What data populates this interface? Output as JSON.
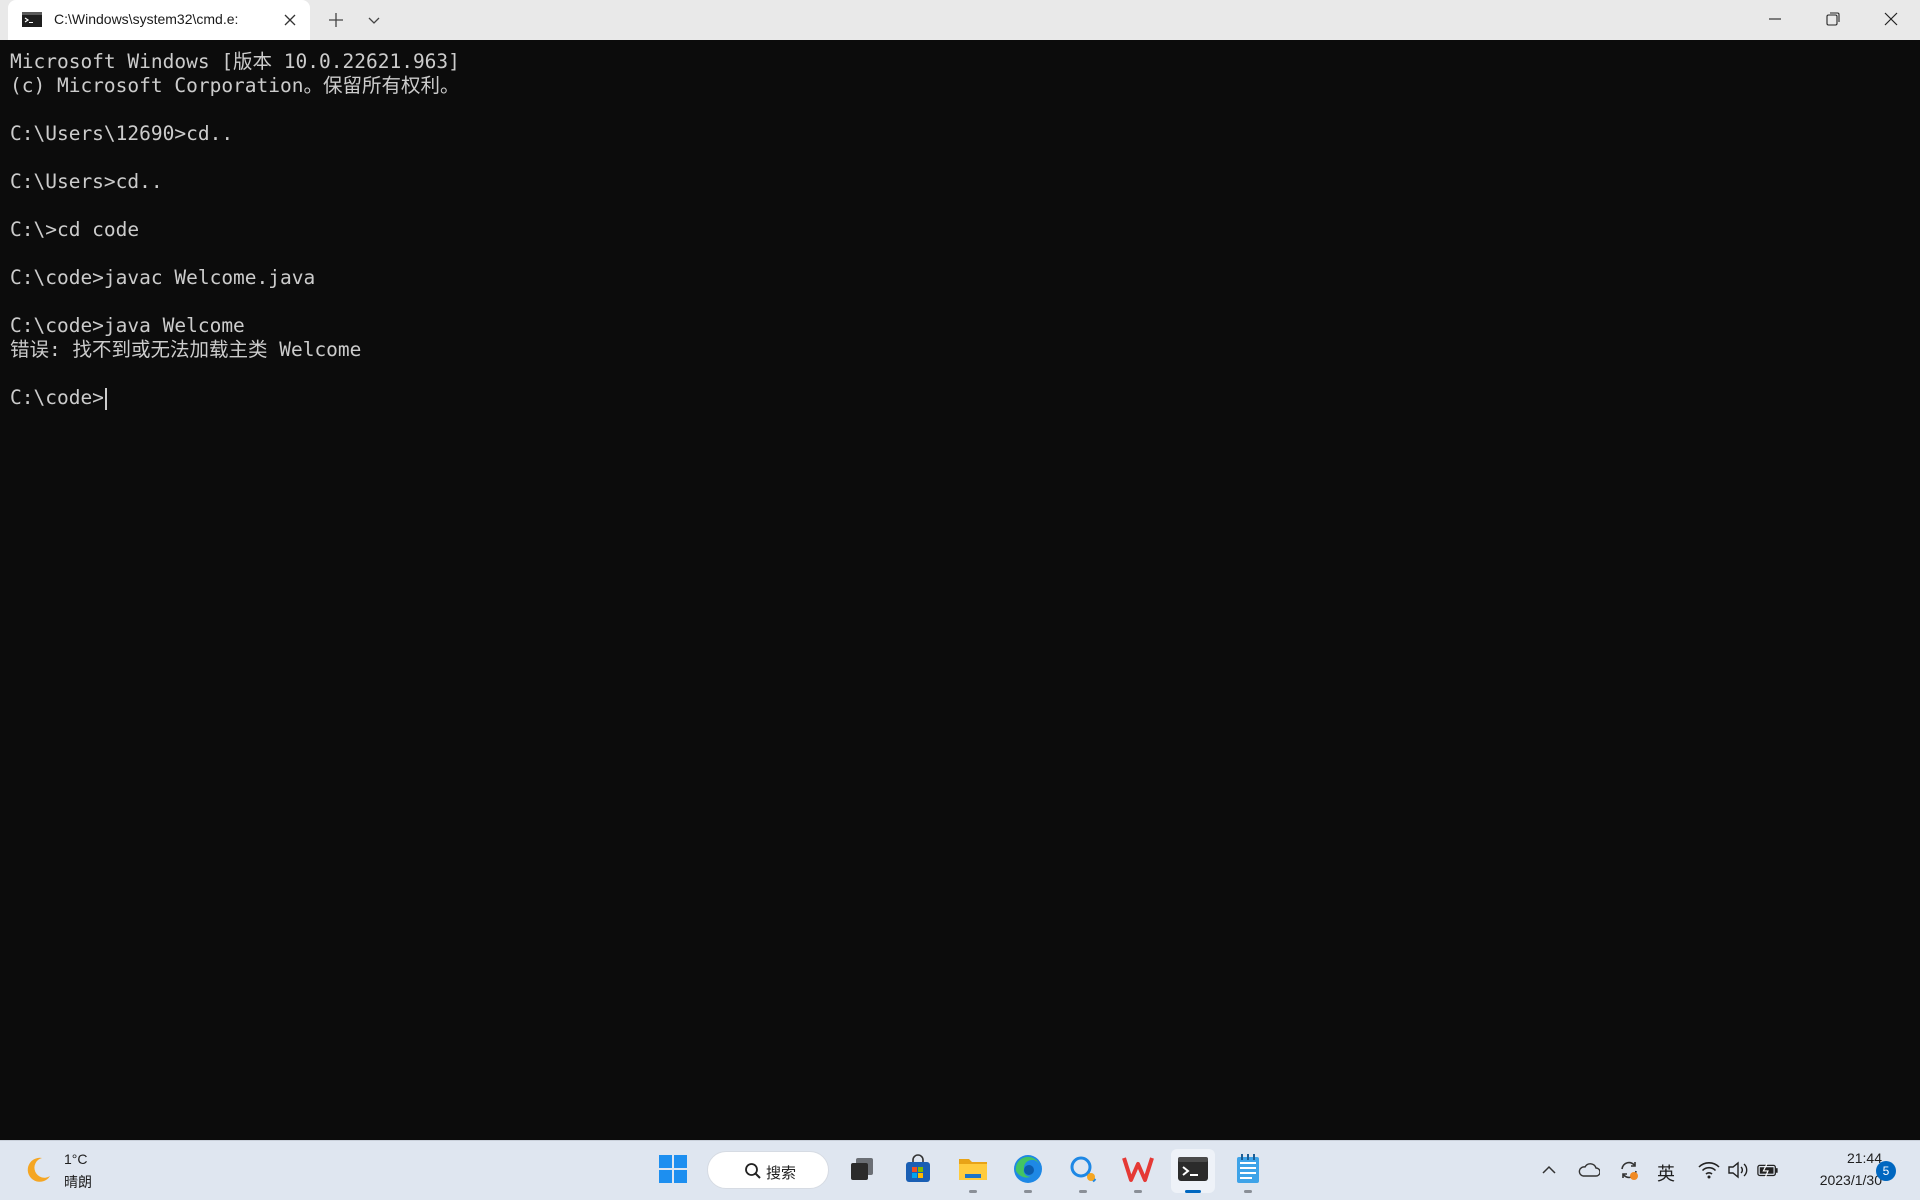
{
  "window": {
    "tab_title": "C:\\Windows\\system32\\cmd.e:",
    "icons": {
      "tab": "cmd-icon",
      "close_tab": "close-icon",
      "new_tab": "plus-icon",
      "dropdown": "chevron-down-icon",
      "minimize": "minimize-icon",
      "maximize": "restore-icon",
      "close": "close-icon"
    }
  },
  "terminal": {
    "lines": [
      "Microsoft Windows [版本 10.0.22621.963]",
      "(c) Microsoft Corporation。保留所有权利。",
      "",
      "C:\\Users\\12690>cd..",
      "",
      "C:\\Users>cd..",
      "",
      "C:\\>cd code",
      "",
      "C:\\code>javac Welcome.java",
      "",
      "C:\\code>java Welcome",
      "错误: 找不到或无法加载主类 Welcome",
      "",
      "C:\\code>"
    ],
    "text_color": "#cccccc",
    "background": "#0c0c0c"
  },
  "taskbar": {
    "weather": {
      "temp": "1°C",
      "condition": "晴朗",
      "icon": "moon-icon"
    },
    "search_label": "搜索",
    "apps": [
      {
        "name": "start-button",
        "icon": "windows-logo-icon"
      },
      {
        "name": "task-view-button",
        "icon": "task-view-icon"
      },
      {
        "name": "microsoft-store-button",
        "icon": "store-icon"
      },
      {
        "name": "file-explorer-button",
        "icon": "folder-icon"
      },
      {
        "name": "edge-button",
        "icon": "edge-icon"
      },
      {
        "name": "search-app-button",
        "icon": "magnifier-app-icon"
      },
      {
        "name": "wps-button",
        "icon": "wps-icon"
      },
      {
        "name": "terminal-button",
        "icon": "terminal-icon"
      },
      {
        "name": "notepad-button",
        "icon": "notepad-icon"
      }
    ],
    "tray": {
      "ime": "英",
      "time": "21:44",
      "date": "2023/1/30",
      "notifications": "5"
    }
  },
  "colors": {
    "accent": "#0067c0",
    "taskbar": "#dfe6f0",
    "titlebar": "#e9e9e9"
  }
}
